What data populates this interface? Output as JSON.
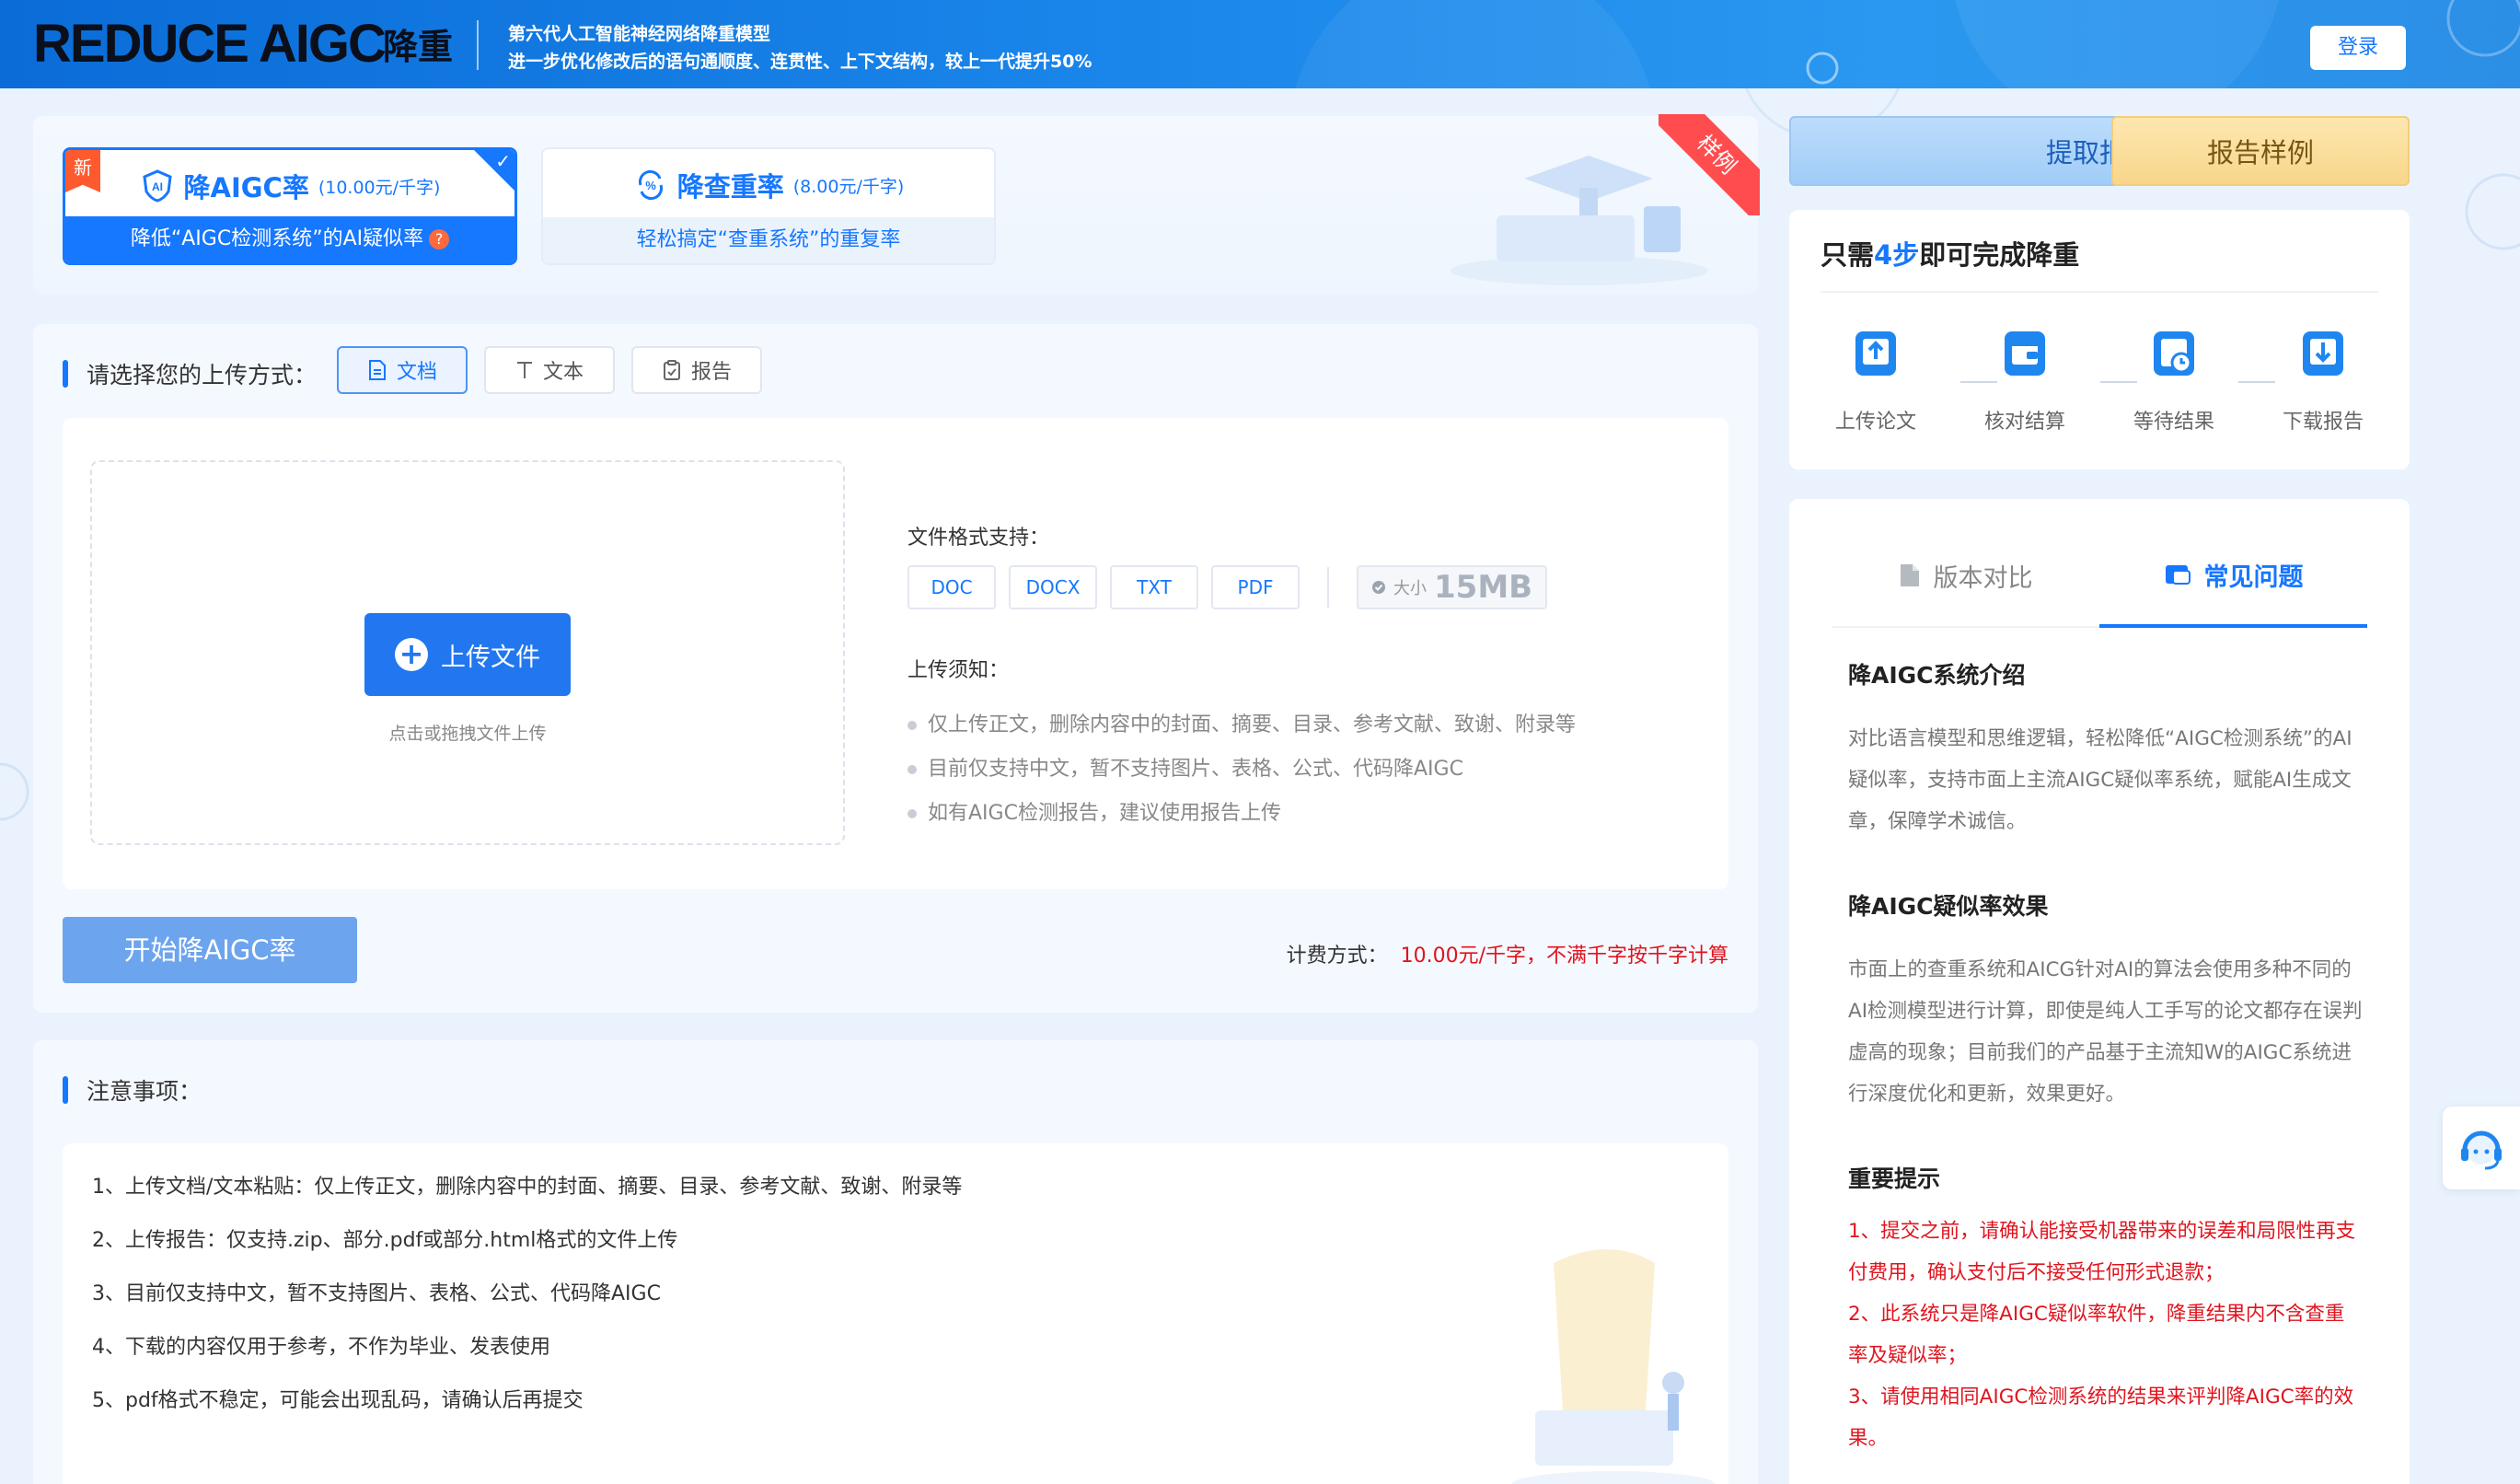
{
  "header": {
    "logo": "REDUCE AIGC",
    "logo_sub": "降重",
    "desc_line1": "第六代人工智能神经网络降重模型",
    "desc_line2": "进一步优化修改后的语句通顺度、连贯性、上下文结构，较上一代提升50%",
    "login_label": "登录"
  },
  "modes": {
    "ribbon": "样例",
    "new_tag": "新",
    "aigc": {
      "title": "降AIGC率",
      "price": "(10.00元/千字)",
      "desc": "降低“AIGC检测系统”的AI疑似率",
      "help": "?"
    },
    "dup": {
      "title": "降查重率",
      "price": "(8.00元/千字)",
      "desc": "轻松搞定“查重系统”的重复率"
    }
  },
  "upload": {
    "section_title": "请选择您的上传方式：",
    "tabs": [
      {
        "label": "文档",
        "active": true
      },
      {
        "label": "文本",
        "active": false
      },
      {
        "label": "报告",
        "active": false
      }
    ],
    "upload_button": "上传文件",
    "drop_hint": "点击或拖拽文件上传",
    "formats_label": "文件格式支持：",
    "formats": [
      "DOC",
      "DOCX",
      "TXT",
      "PDF"
    ],
    "size_small": "大小",
    "size_value": "15MB",
    "notice_label": "上传须知：",
    "notices": [
      "仅上传正文，删除内容中的封面、摘要、目录、参考文献、致谢、附录等",
      "目前仅支持中文，暂不支持图片、表格、公式、代码降AIGC",
      "如有AIGC检测报告，建议使用报告上传"
    ],
    "start_button": "开始降AIGC率",
    "billing_label": "计费方式：",
    "billing_value": "10.00元/千字，不满千字按千字计算"
  },
  "notes": {
    "section_title": "注意事项：",
    "items": [
      "1、上传文档/文本粘贴：仅上传正文，删除内容中的封面、摘要、目录、参考文献、致谢、附录等",
      "2、上传报告：仅支持.zip、部分.pdf或部分.html格式的文件上传",
      "3、目前仅支持中文，暂不支持图片、表格、公式、代码降AIGC",
      "4、下载的内容仅用于参考，不作为毕业、发表使用",
      "5、pdf格式不稳定，可能会出现乱码，请确认后再提交"
    ]
  },
  "sidebar": {
    "extract_report": "提取报告",
    "report_sample": "报告样例",
    "steps_title_pre": "只需",
    "steps_title_hl": "4步",
    "steps_title_post": "即可完成降重",
    "steps": [
      {
        "label": "上传论文",
        "icon": "upload-paper-icon"
      },
      {
        "label": "核对结算",
        "icon": "checkout-icon"
      },
      {
        "label": "等待结果",
        "icon": "wait-clock-icon"
      },
      {
        "label": "下载报告",
        "icon": "download-report-icon"
      }
    ],
    "faq_tabs": [
      {
        "label": "版本对比",
        "active": false
      },
      {
        "label": "常见问题",
        "active": true
      }
    ],
    "faq": [
      {
        "title": "降AIGC系统介绍",
        "body": "对比语言模型和思维逻辑，轻松降低“AIGC检测系统”的AI疑似率，支持市面上主流AIGC疑似率系统，赋能AI生成文章，保障学术诚信。"
      },
      {
        "title": "降AIGC疑似率效果",
        "body": "市面上的查重系统和AICG针对AI的算法会使用多种不同的AI检测模型进行计算，即使是纯人工手写的论文都存在误判虚高的现象；目前我们的产品基于主流知W的AIGC系统进行深度优化和更新，效果更好。"
      },
      {
        "title": "重要提示",
        "lines": [
          "1、提交之前，请确认能接受机器带来的误差和局限性再支付费用，确认支付后不接受任何形式退款；",
          "2、此系统只是降AIGC疑似率软件，降重结果内不含查重率及疑似率；",
          "3、请使用相同AIGC检测系统的结果来评判降AIGC率的效果。"
        ]
      }
    ]
  },
  "colors": {
    "accent": "#1677ff",
    "warning": "#e0141e",
    "header": "#1a86ea"
  }
}
